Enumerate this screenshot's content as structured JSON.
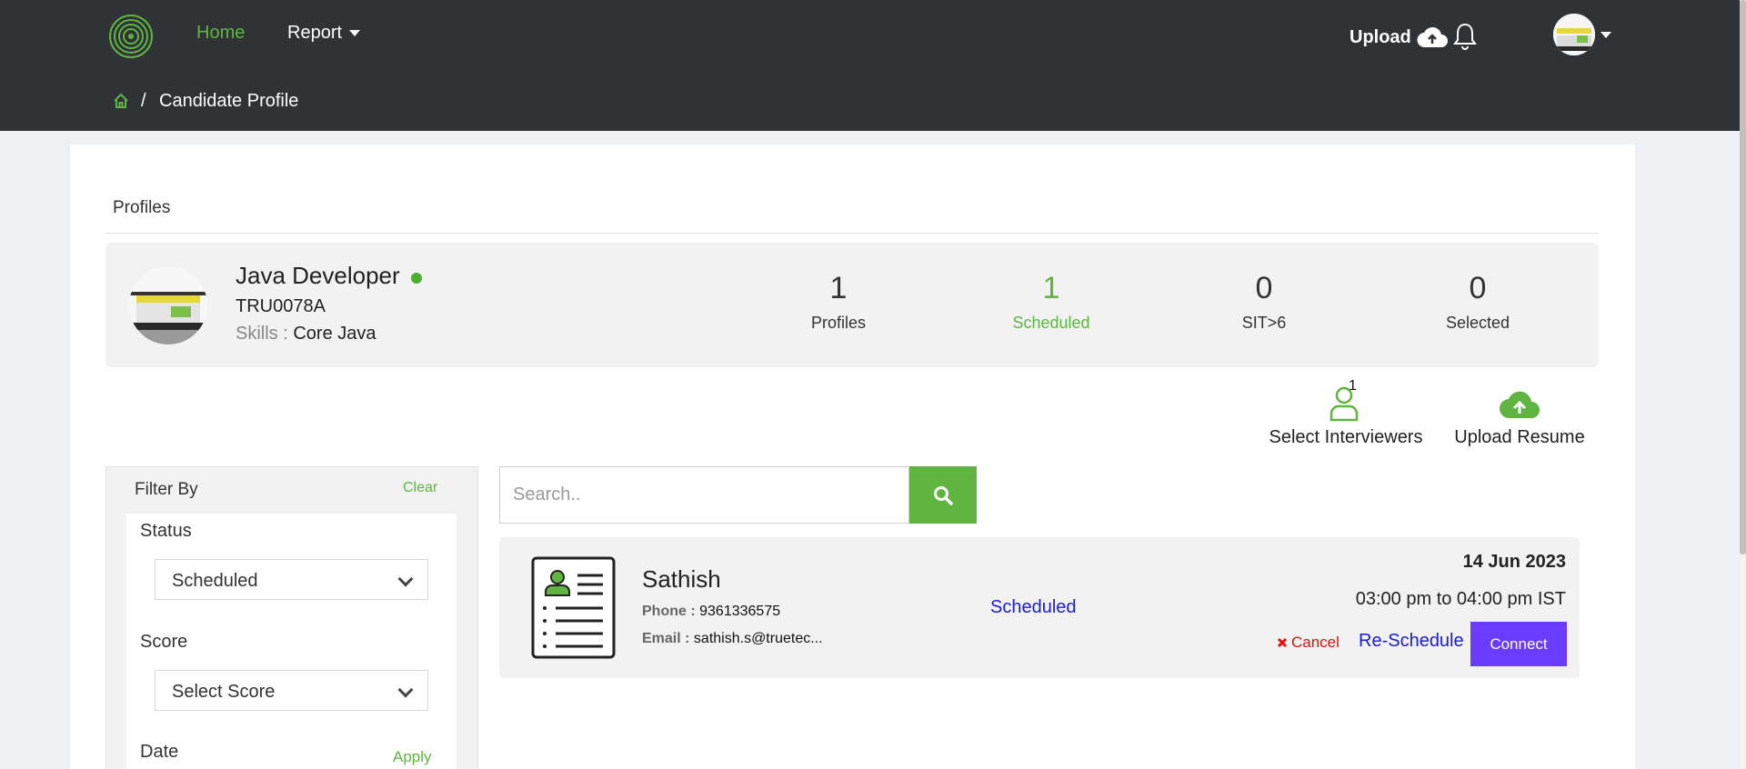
{
  "nav": {
    "home_label": "Home",
    "report_label": "Report",
    "upload_label": "Upload"
  },
  "breadcrumb": {
    "current": "Candidate Profile",
    "separator": "/"
  },
  "page": {
    "section_title": "Profiles"
  },
  "job": {
    "title": "Java Developer",
    "code": "TRU0078A",
    "skills_key": "Skills :",
    "skills_value": "Core Java",
    "status_color": "#4caf2e"
  },
  "stats": [
    {
      "value": "1",
      "label": "Profiles"
    },
    {
      "value": "1",
      "label": "Scheduled"
    },
    {
      "value": "0",
      "label": "SIT>6"
    },
    {
      "value": "0",
      "label": "Selected"
    }
  ],
  "actions": {
    "select_interviewers": "Select Interviewers",
    "interviewers_badge": "1",
    "upload_resume": "Upload Resume"
  },
  "filter": {
    "title": "Filter By",
    "clear": "Clear",
    "status_label": "Status",
    "status_value": "Scheduled",
    "score_label": "Score",
    "score_value": "Select Score",
    "date_label": "Date",
    "apply": "Apply"
  },
  "search": {
    "placeholder": "Search.."
  },
  "candidate": {
    "name": "Sathish",
    "phone_key": "Phone :",
    "phone": "9361336575",
    "email_key": "Email :",
    "email": "sathish.s@truetec...",
    "status": "Scheduled",
    "date": "14 Jun 2023",
    "time": "03:00 pm to 04:00 pm IST",
    "cancel": "Cancel",
    "reschedule": "Re-Schedule",
    "connect": "Connect"
  },
  "colors": {
    "accent": "#5fb540",
    "nav_bg": "#2f3336",
    "link_blue": "#1a1adc",
    "connect_bg": "#6a3cff",
    "cancel_red": "#e01010"
  }
}
